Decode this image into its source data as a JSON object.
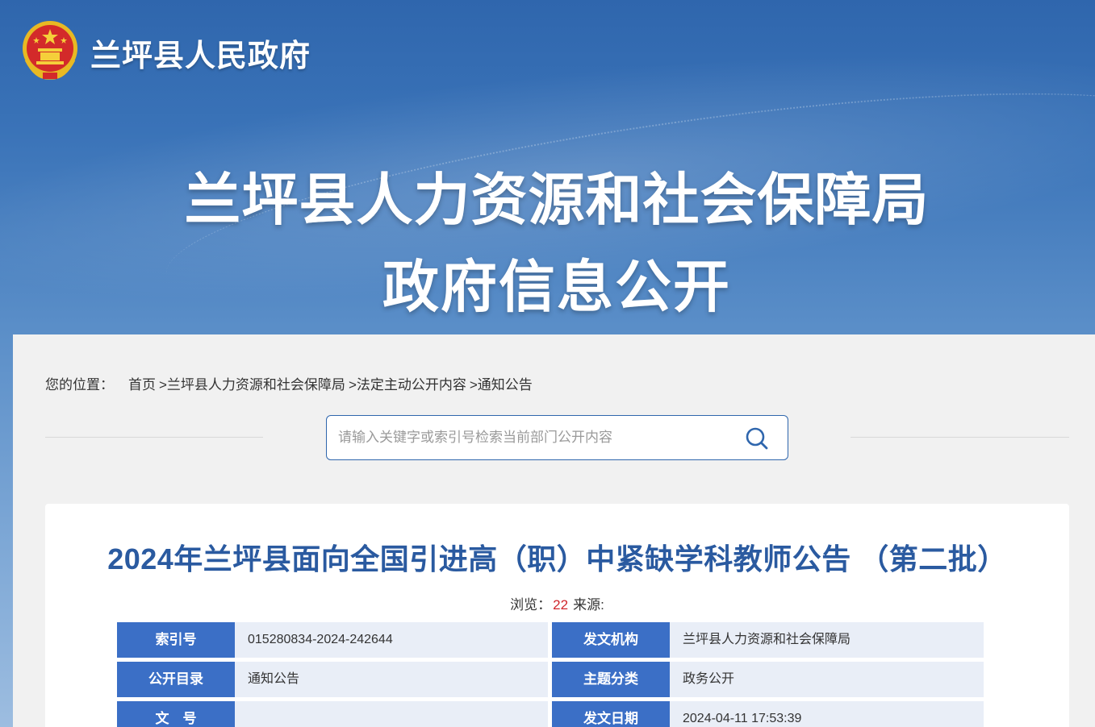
{
  "header": {
    "site_title": "兰坪县人民政府",
    "dept_title": "兰坪县人力资源和社会保障局",
    "dept_subtitle": "政府信息公开"
  },
  "breadcrumb": {
    "prefix": "您的位置：",
    "items": [
      "首页",
      ">兰坪县人力资源和社会保障局",
      ">法定主动公开内容",
      ">通知公告"
    ]
  },
  "search": {
    "placeholder": "请输入关键字或索引号检索当前部门公开内容",
    "value": ""
  },
  "article": {
    "title": "2024年兰坪县面向全国引进高（职）中紧缺学科教师公告 （第二批）",
    "views_label": "浏览：",
    "views": "22",
    "source_label": "来源:",
    "source": ""
  },
  "info": [
    {
      "left_label": "索引号",
      "left_value": "015280834-2024-242644",
      "right_label": "发文机构",
      "right_value": "兰坪县人力资源和社会保障局"
    },
    {
      "left_label": "公开目录",
      "left_value": "通知公告",
      "right_label": "主题分类",
      "right_value": "政务公开"
    },
    {
      "left_label": "文　号",
      "left_value": "",
      "right_label": "发文日期",
      "right_value": "2024-04-11 17:53:39"
    }
  ],
  "colors": {
    "banner_blue": "#2f66ad",
    "title_blue": "#2a5aa0",
    "label_blue": "#3b6fc6",
    "count_red": "#d0262c",
    "value_bg": "#e9eef7"
  },
  "icons": {
    "emblem": "national-emblem-icon",
    "search": "search-icon"
  }
}
